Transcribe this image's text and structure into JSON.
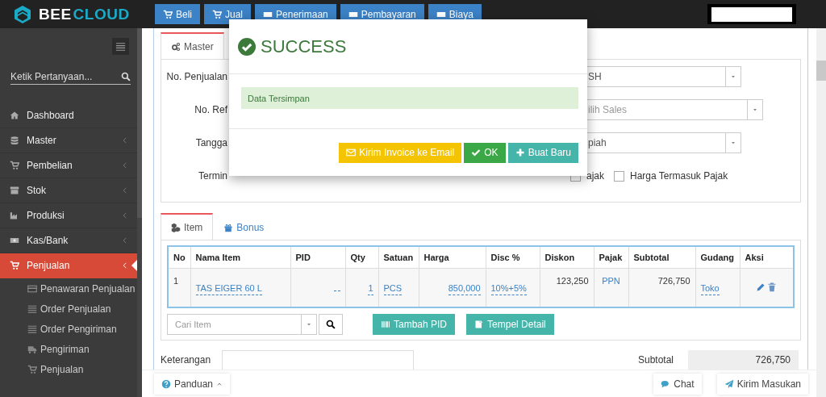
{
  "header": {
    "logo": {
      "first": "BEE",
      "second": "CLOUD"
    },
    "nav": [
      {
        "label": "Beli"
      },
      {
        "label": "Jual"
      },
      {
        "label": "Penerimaan"
      },
      {
        "label": "Pembayaran"
      },
      {
        "label": "Biaya"
      }
    ]
  },
  "sidebar": {
    "search": {
      "placeholder": "Ketik Pertanyaan..."
    },
    "items": [
      {
        "label": "Dashboard",
        "has_submenu": false,
        "selected": false
      },
      {
        "label": "Master",
        "has_submenu": true,
        "selected": false
      },
      {
        "label": "Pembelian",
        "has_submenu": true,
        "selected": false
      },
      {
        "label": "Stok",
        "has_submenu": true,
        "selected": false
      },
      {
        "label": "Produksi",
        "has_submenu": true,
        "selected": false
      },
      {
        "label": "Kas/Bank",
        "has_submenu": true,
        "selected": false
      },
      {
        "label": "Penjualan",
        "has_submenu": true,
        "selected": true,
        "children": [
          {
            "label": "Penawaran Penjualan"
          },
          {
            "label": "Order Penjualan"
          },
          {
            "label": "Order Pengiriman"
          },
          {
            "label": "Pengiriman"
          },
          {
            "label": "Penjualan"
          }
        ]
      }
    ]
  },
  "master_tabs": [
    {
      "label": "Master",
      "selected": true
    }
  ],
  "form": {
    "labels": [
      "No. Penjualan",
      "No. Ref",
      "Tangga",
      "Termin"
    ],
    "selects": [
      {
        "value": "SH"
      },
      {
        "placeholder": "ilih Sales"
      },
      {
        "value": "piah"
      }
    ],
    "checkboxes": [
      {
        "label": "ajak",
        "checked": false
      },
      {
        "label": "Harga Termasuk Pajak",
        "checked": false
      }
    ]
  },
  "item_tabs": [
    {
      "label": "Item",
      "selected": true
    },
    {
      "label": "Bonus",
      "selected": false
    }
  ],
  "table": {
    "columns": [
      "No",
      "Nama Item",
      "PID",
      "Qty",
      "Satuan",
      "Harga",
      "Disc %",
      "Diskon",
      "Pajak",
      "Subtotal",
      "Gudang",
      "Aksi"
    ],
    "rows": [
      {
        "no": "1",
        "name": "TAS EIGER 60 L",
        "qty": "1",
        "unit": "PCS",
        "price": "850,000",
        "disc": "10%+5%",
        "discount": "123,250",
        "tax": "PPN",
        "subtotal": "726,750",
        "warehouse": "Toko"
      }
    ]
  },
  "item_search": {
    "placeholder": "Cari Item"
  },
  "item_buttons": [
    {
      "label": "Tambah PID"
    },
    {
      "label": "Tempel Detail"
    }
  ],
  "notes": {
    "label": "Keterangan"
  },
  "summary": {
    "label": "Subtotal",
    "value": "726,750"
  },
  "footer": {
    "guide": "Panduan",
    "chat": "Chat",
    "feedback": "Kirim Masukan"
  },
  "modal": {
    "title": "SUCCESS",
    "message": "Data Tersimpan",
    "buttons": [
      {
        "label": "Kirim Invoice ke Email",
        "kind": "warning"
      },
      {
        "label": "OK",
        "kind": "success"
      },
      {
        "label": "Buat Baru",
        "kind": "info"
      }
    ]
  }
}
